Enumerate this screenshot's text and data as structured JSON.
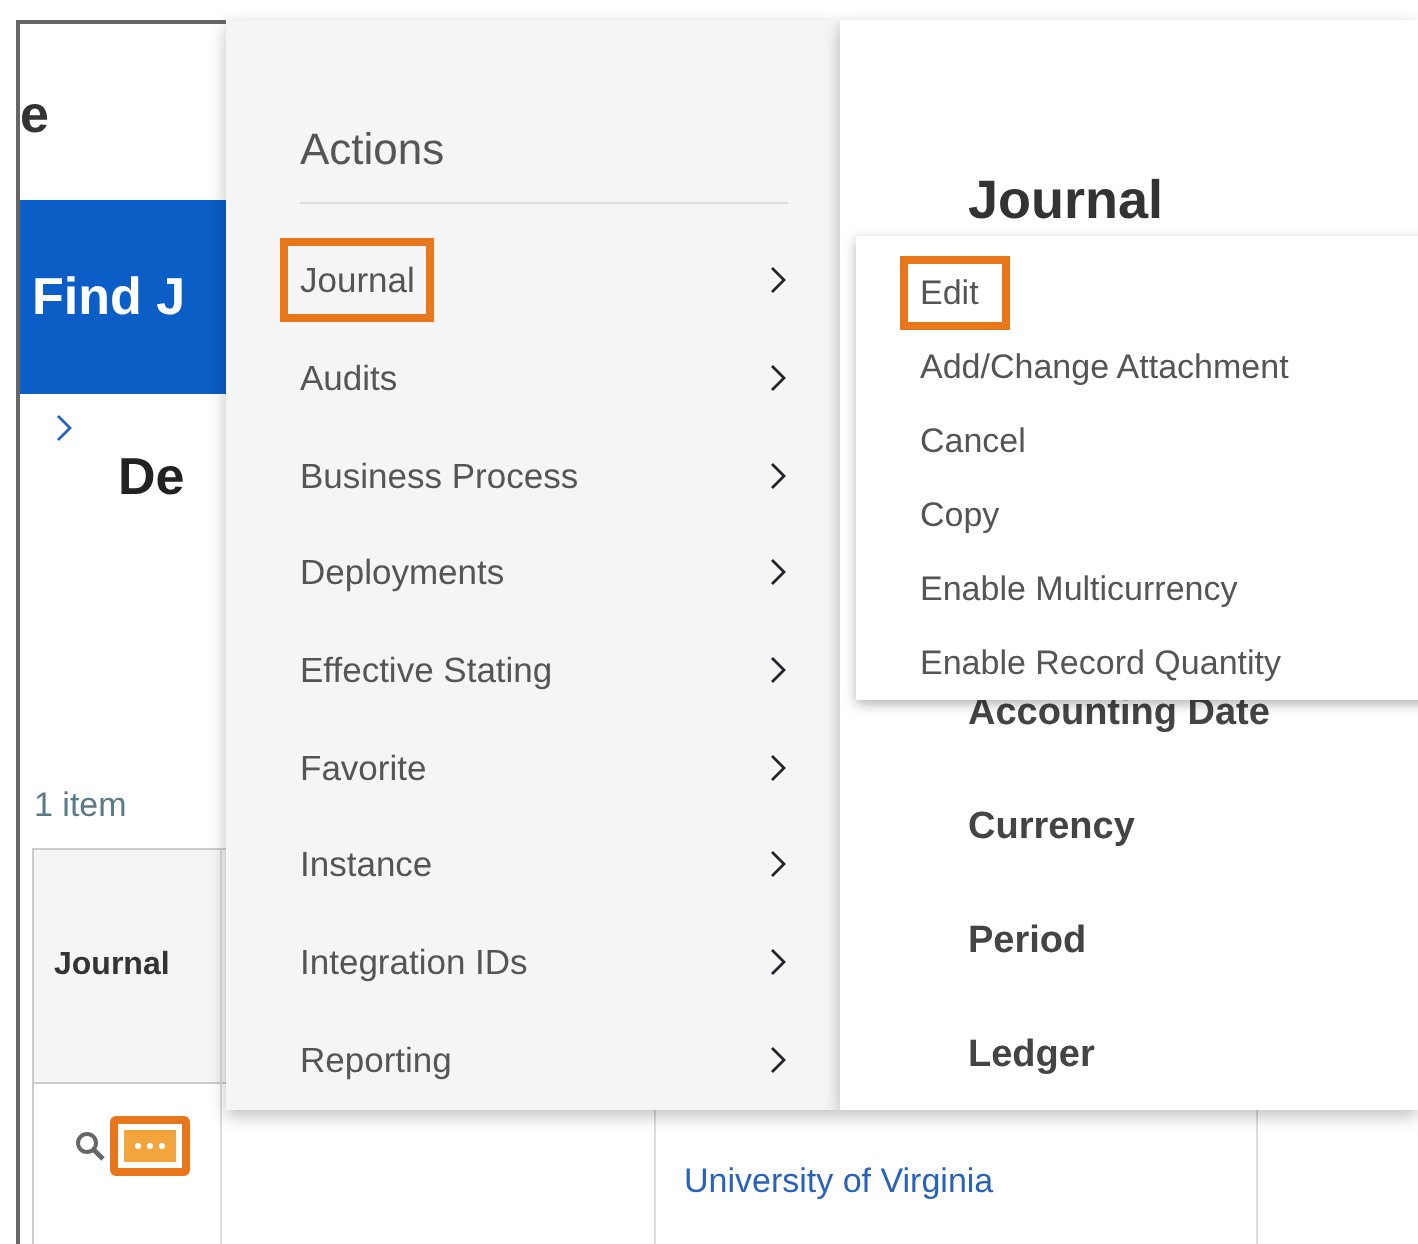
{
  "page": {
    "title_fragment": "e",
    "banner_title": "Find J",
    "heading_fragment": "De",
    "item_count": "1 item",
    "table": {
      "columns": [
        "Journal"
      ],
      "rows": [
        {
          "organization": "University of Virginia",
          "actions_button": {
            "highlighted": true
          }
        }
      ]
    }
  },
  "actions_menu": {
    "title": "Actions",
    "items": [
      {
        "label": "Journal",
        "highlighted": true
      },
      {
        "label": "Audits",
        "highlighted": false
      },
      {
        "label": "Business Process",
        "highlighted": false
      },
      {
        "label": "Deployments",
        "highlighted": false
      },
      {
        "label": "Effective Stating",
        "highlighted": false
      },
      {
        "label": "Favorite",
        "highlighted": false
      },
      {
        "label": "Instance",
        "highlighted": false
      },
      {
        "label": "Integration IDs",
        "highlighted": false
      },
      {
        "label": "Reporting",
        "highlighted": false
      }
    ]
  },
  "detail_panel": {
    "title": "Journal",
    "fields": [
      "Accounting Date",
      "Currency",
      "Period",
      "Ledger"
    ]
  },
  "submenu": {
    "items": [
      {
        "label": "Edit",
        "highlighted": true
      },
      {
        "label": "Add/Change Attachment",
        "highlighted": false
      },
      {
        "label": "Cancel",
        "highlighted": false
      },
      {
        "label": "Copy",
        "highlighted": false
      },
      {
        "label": "Enable Multicurrency",
        "highlighted": false
      },
      {
        "label": "Enable Record Quantity",
        "highlighted": false
      }
    ]
  }
}
